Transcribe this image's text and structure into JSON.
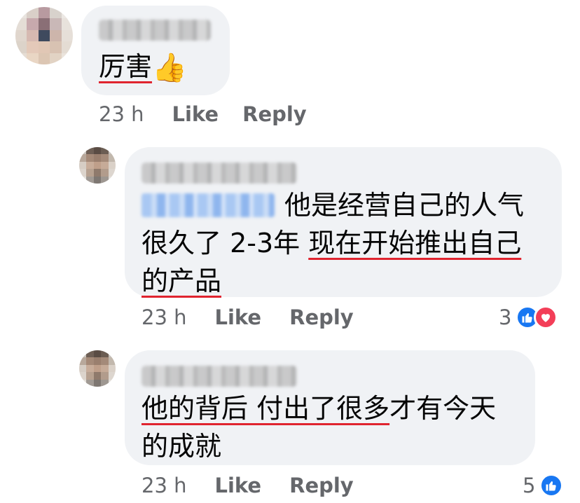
{
  "comments": [
    {
      "author": "",
      "text_parts": [
        "厉害"
      ],
      "emoji": "👍",
      "time": "23 h",
      "like_label": "Like",
      "reply_label": "Reply"
    },
    {
      "author": "",
      "mention": "",
      "line1": "他是经营自己的人气",
      "line2_plain": "很久了 2-3年 ",
      "line2_underlined": "现在开始推出自己",
      "line3": "的产品",
      "time": "23 h",
      "like_label": "Like",
      "reply_label": "Reply",
      "reaction_count": "3",
      "reactions": [
        "like-icon",
        "love-icon"
      ]
    },
    {
      "author": "",
      "line1_underlined": "他的背后 付出了很多",
      "line1_rest": "才有今天",
      "line2": "的成就",
      "time": "23 h",
      "like_label": "Like",
      "reply_label": "Reply",
      "reaction_count": "5",
      "reactions": [
        "like-icon"
      ]
    }
  ],
  "colors": {
    "bubble": "#f0f2f5",
    "meta_text": "#65676b",
    "underline": "#e0242f",
    "like": "#1877f2",
    "love": "#f33e58"
  }
}
